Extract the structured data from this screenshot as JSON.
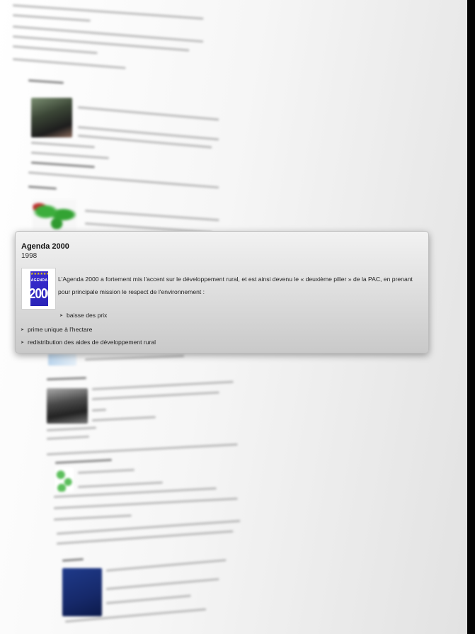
{
  "popover": {
    "title": "Agenda 2000",
    "year": "1998",
    "logo": {
      "word": "AGENDA",
      "year": "2000",
      "stars": "★★★★★★",
      "colors": {
        "background": "#2a24b8",
        "stars": "#f2d400",
        "text": "#ffffff"
      }
    },
    "description": "L'Agenda 2000 a fortement mis l'accent sur le développement rural, et est ainsi devenu le « deuxième pilier » de la PAC, en prenant pour principale mission le respect de l'environnement :",
    "bullets": [
      {
        "text": "baisse des prix",
        "icon": "arrow-bullet-icon"
      },
      {
        "text": "prime unique à l'hectare",
        "icon": "arrow-bullet-icon"
      },
      {
        "text": "redistribution des aides de développement rural",
        "icon": "arrow-bullet-icon"
      }
    ]
  },
  "colors": {
    "popover_bg_top": "#f2f2f2",
    "popover_bg_bottom": "#c9c9c9",
    "right_edge": "#050505"
  }
}
